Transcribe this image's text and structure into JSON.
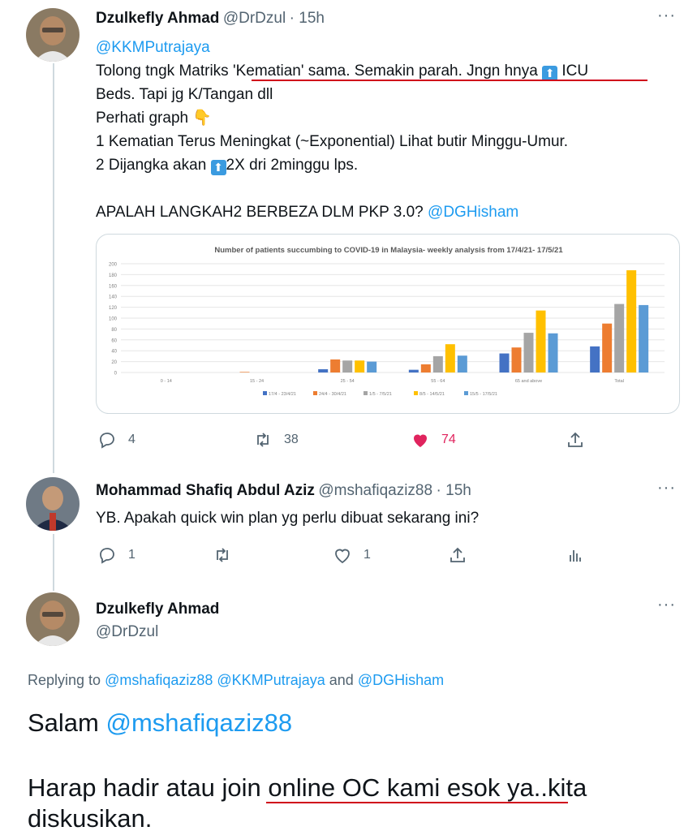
{
  "tweet1": {
    "name": "Dzulkefly Ahmad",
    "handle": "@DrDzul",
    "time": "· 15h",
    "mention": "@KKMPutrajaya",
    "line1_a": "Tolong tngk Matriks 'Kematian' sama. Semakin parah. Jngn hnya",
    "line1_b": "ICU",
    "line2": "Beds. Tapi jg K/Tangan dll",
    "line3": "Perhati graph",
    "line4": "1 Kematian Terus Meningkat (~Exponential) Lihat butir Minggu-Umur.",
    "line5_a": "2 Dijangka akan",
    "line5_b": "2X dri 2minggu lps.",
    "line6": "APALAH LANGKAH2 BERBEZA DLM PKP 3.0?",
    "line6_mention": "@DGHisham",
    "replies": "4",
    "retweets": "38",
    "likes": "74"
  },
  "tweet2": {
    "name": "Mohammad Shafiq Abdul Aziz",
    "handle": "@mshafiqaziz88",
    "time": "· 15h",
    "text": "YB. Apakah quick win plan yg perlu dibuat sekarang ini?",
    "replies": "1",
    "likes": "1"
  },
  "tweet3": {
    "name": "Dzulkefly Ahmad",
    "handle": "@DrDzul",
    "replying_prefix": "Replying to",
    "replying_to": "@mshafiqaziz88 @KKMPutrajaya",
    "replying_and": "and",
    "replying_last": "@DGHisham",
    "salam": "Salam",
    "salam_mention": "@mshafiqaziz88",
    "text_a": "Harap hadir atau join online OC kami esok ya..kita",
    "text_b": "diskusikan."
  },
  "colors": {
    "accent": "#1d9bf0",
    "like": "#e0245e",
    "underline": "#d0021b"
  },
  "chart_data": {
    "type": "bar",
    "title": "Number of patients succumbing to COVID-19 in Malaysia- weekly analysis from 17/4/21- 17/5/21",
    "categories": [
      "0 - 14",
      "15 - 24",
      "25 - 54",
      "55 - 64",
      "65 and above",
      "Total"
    ],
    "ylim": [
      0,
      200
    ],
    "yticks": [
      0,
      20,
      40,
      60,
      80,
      100,
      120,
      140,
      160,
      180,
      200
    ],
    "series": [
      {
        "name": "17/4 - 23/4/21",
        "color": "#4472c4",
        "values": [
          0,
          0,
          6,
          5,
          35,
          48
        ]
      },
      {
        "name": "24/4 - 30/4/21",
        "color": "#ed7d31",
        "values": [
          0,
          1,
          24,
          15,
          46,
          90
        ]
      },
      {
        "name": "1/5 - 7/5/21",
        "color": "#a5a5a5",
        "values": [
          0,
          0,
          22,
          30,
          73,
          126
        ]
      },
      {
        "name": "8/5 - 14/5/21",
        "color": "#ffc000",
        "values": [
          0,
          0,
          22,
          52,
          114,
          188
        ]
      },
      {
        "name": "15/5 - 17/5/21",
        "color": "#5b9bd5",
        "values": [
          0,
          0,
          20,
          31,
          72,
          124
        ]
      }
    ]
  }
}
